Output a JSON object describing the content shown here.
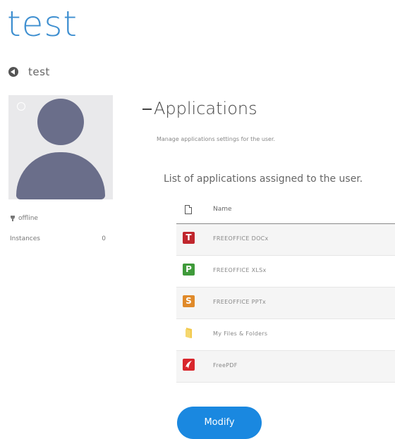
{
  "page": {
    "title": "test"
  },
  "back": {
    "label": "test"
  },
  "user": {
    "status": "offline",
    "instances_label": "Instances",
    "instances_value": "0"
  },
  "section": {
    "title": "Applications",
    "subtitle": "Manage applications settings for the user.",
    "list_heading": "List of applications assigned to the user."
  },
  "table": {
    "column_name": "Name",
    "apps": [
      {
        "name": "FREEOFFICE DOCx",
        "icon": "freeoffice-textmaker-icon",
        "glyph": "T",
        "color": "#c0262d"
      },
      {
        "name": "FREEOFFICE XLSx",
        "icon": "freeoffice-planmaker-icon",
        "glyph": "P",
        "color": "#3f9a3a"
      },
      {
        "name": "FREEOFFICE PPTx",
        "icon": "freeoffice-presentations-icon",
        "glyph": "S",
        "color": "#e08a2a"
      },
      {
        "name": "My Files & Folders",
        "icon": "folder-icon",
        "glyph": "",
        "color": "#f2c94c"
      },
      {
        "name": "FreePDF",
        "icon": "freepdf-icon",
        "glyph": "",
        "color": "#d8262c"
      }
    ]
  },
  "actions": {
    "modify_label": "Modify"
  },
  "colors": {
    "accent": "#3e8fd0",
    "button": "#1a88e0",
    "avatar": "#6a6e8a"
  }
}
